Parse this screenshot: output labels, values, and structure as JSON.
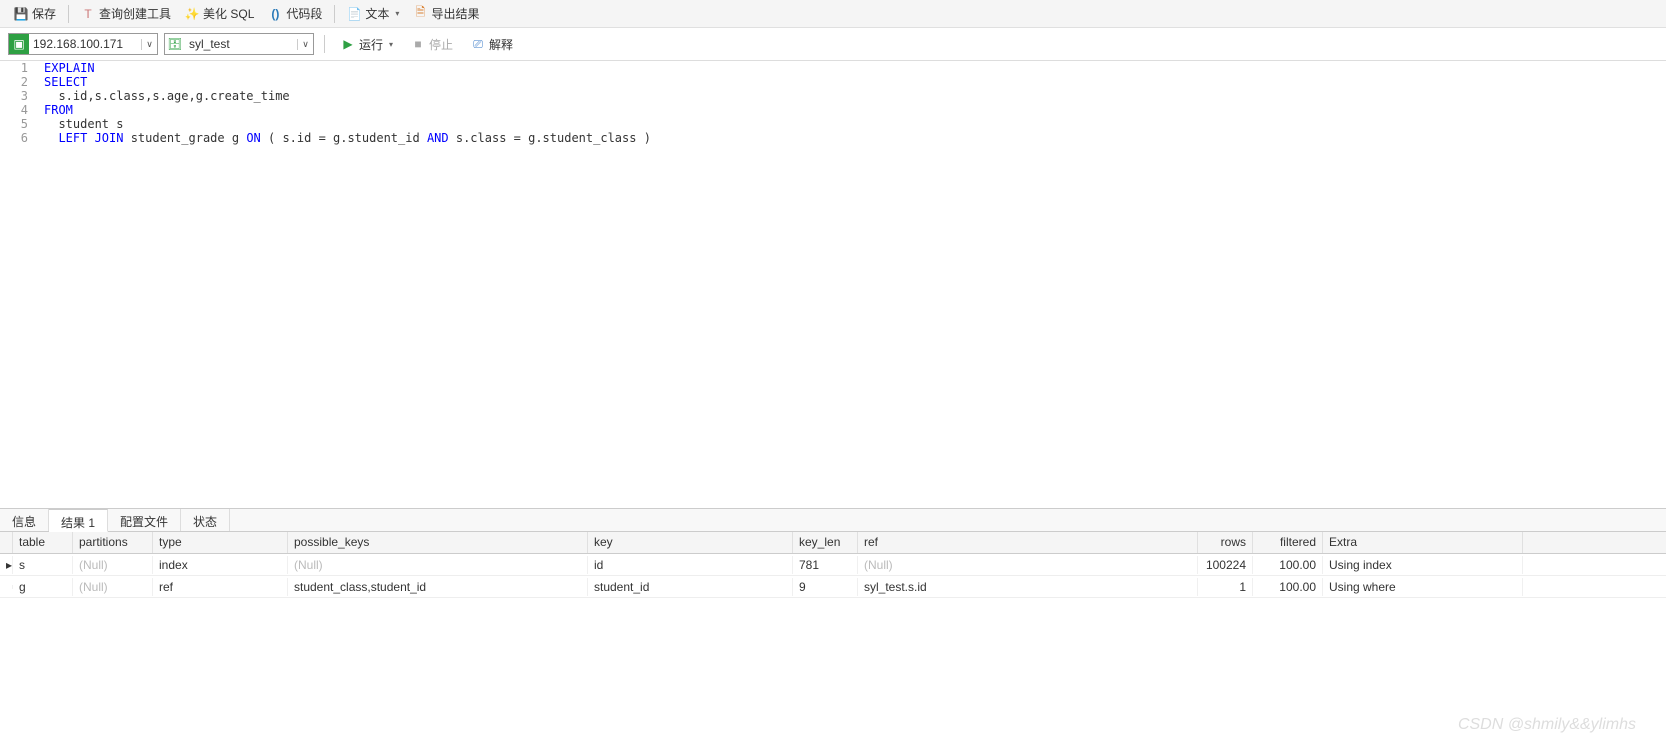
{
  "toolbar": {
    "save": "保存",
    "query_tool": "查询创建工具",
    "beautify": "美化 SQL",
    "snippet": "代码段",
    "text": "文本",
    "export": "导出结果"
  },
  "connection": {
    "host": "192.168.100.171",
    "database": "syl_test",
    "run": "运行",
    "stop": "停止",
    "explain": "解释"
  },
  "editor": {
    "lines": [
      "1",
      "2",
      "3",
      "4",
      "5",
      "6"
    ],
    "code": [
      {
        "parts": [
          {
            "t": "EXPLAIN",
            "c": "kw"
          }
        ]
      },
      {
        "parts": [
          {
            "t": "SELECT",
            "c": "kw"
          }
        ]
      },
      {
        "parts": [
          {
            "t": "  s.id,s.class,s.age,g.create_time",
            "c": "txt"
          }
        ]
      },
      {
        "parts": [
          {
            "t": "FROM",
            "c": "kw"
          }
        ]
      },
      {
        "parts": [
          {
            "t": "  student s",
            "c": "txt"
          }
        ]
      },
      {
        "parts": [
          {
            "t": "  ",
            "c": "txt"
          },
          {
            "t": "LEFT JOIN",
            "c": "kw"
          },
          {
            "t": " student_grade g ",
            "c": "txt"
          },
          {
            "t": "ON",
            "c": "kw"
          },
          {
            "t": " ( s.id = g.student_id ",
            "c": "txt"
          },
          {
            "t": "AND",
            "c": "kw"
          },
          {
            "t": " s.class = g.student_class )",
            "c": "txt"
          }
        ]
      }
    ]
  },
  "tabs": {
    "info": "信息",
    "result": "结果 1",
    "profile": "配置文件",
    "status": "状态"
  },
  "grid": {
    "headers": {
      "table": "table",
      "partitions": "partitions",
      "type": "type",
      "possible_keys": "possible_keys",
      "key": "key",
      "key_len": "key_len",
      "ref": "ref",
      "rows": "rows",
      "filtered": "filtered",
      "extra": "Extra"
    },
    "rows": [
      {
        "marker": "▸",
        "table": "s",
        "partitions": "(Null)",
        "type": "index",
        "possible_keys": "(Null)",
        "key": "id",
        "key_len": "781",
        "ref": "(Null)",
        "rows": "100224",
        "filtered": "100.00",
        "extra": "Using index",
        "nulls": [
          "partitions",
          "possible_keys",
          "ref"
        ]
      },
      {
        "marker": "",
        "table": "g",
        "partitions": "(Null)",
        "type": "ref",
        "possible_keys": "student_class,student_id",
        "key": "student_id",
        "key_len": "9",
        "ref": "syl_test.s.id",
        "rows": "1",
        "filtered": "100.00",
        "extra": "Using where",
        "nulls": [
          "partitions"
        ]
      }
    ]
  },
  "watermark": "CSDN @shmily&&ylimhs"
}
